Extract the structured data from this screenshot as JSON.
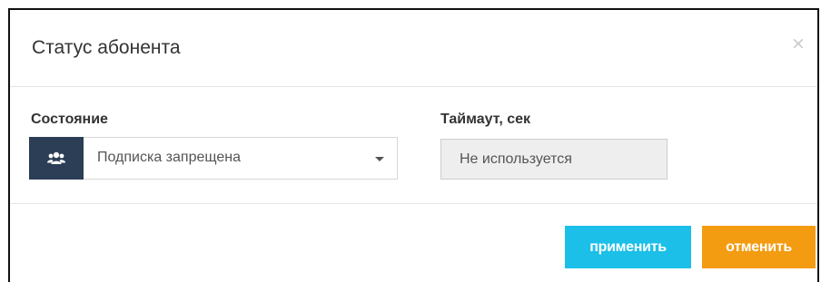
{
  "dialog": {
    "title": "Статус абонента",
    "close_label": "×"
  },
  "state_field": {
    "label": "Состояние",
    "icon": "users-icon",
    "value": "Подписка запрещена"
  },
  "timeout_field": {
    "label": "Таймаут, сек",
    "placeholder": "Не используется",
    "disabled": true
  },
  "footer": {
    "apply_label": "применить",
    "cancel_label": "отменить"
  },
  "colors": {
    "apply": "#1bbfe8",
    "cancel": "#f39c12",
    "addon": "#2c3e55"
  }
}
